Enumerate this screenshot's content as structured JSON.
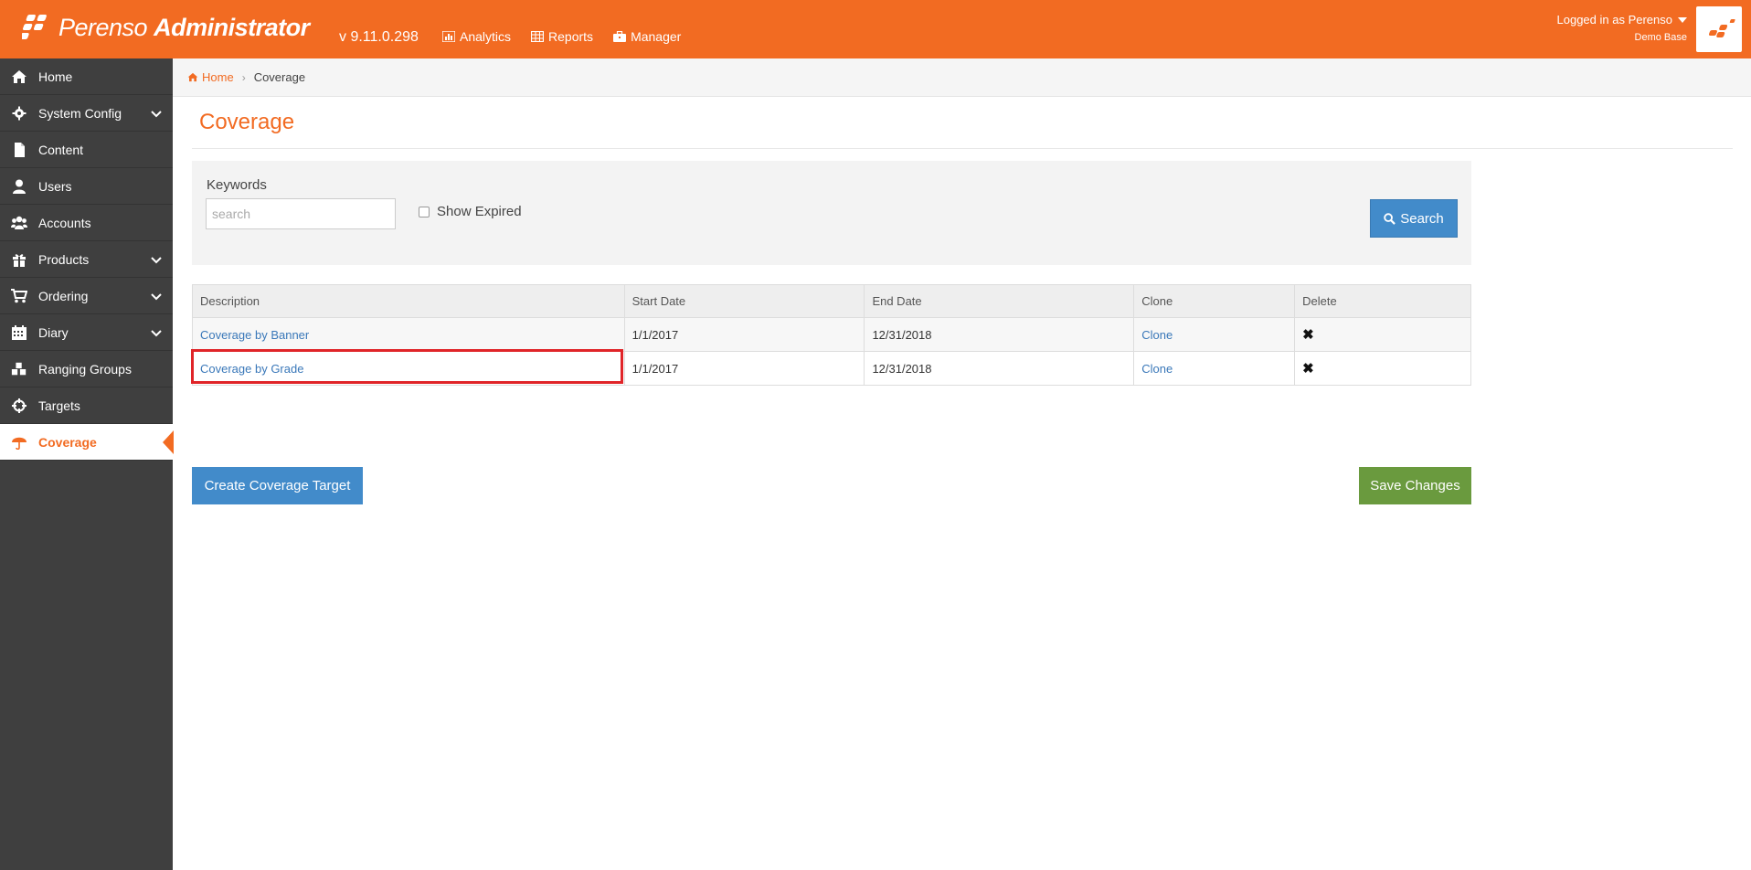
{
  "header": {
    "brand_light": "Perenso",
    "brand_bold": "Administrator",
    "version": "v 9.11.0.298",
    "nav": [
      {
        "label": "Analytics",
        "icon": "bar-chart-icon"
      },
      {
        "label": "Reports",
        "icon": "table-icon"
      },
      {
        "label": "Manager",
        "icon": "briefcase-icon"
      }
    ],
    "login_text": "Logged in as Perenso",
    "account": "Demo Base"
  },
  "sidebar": {
    "items": [
      {
        "label": "Home",
        "icon": "home-icon",
        "expandable": false
      },
      {
        "label": "System Config",
        "icon": "gear-icon",
        "expandable": true
      },
      {
        "label": "Content",
        "icon": "document-icon",
        "expandable": false
      },
      {
        "label": "Users",
        "icon": "user-icon",
        "expandable": false
      },
      {
        "label": "Accounts",
        "icon": "users-icon",
        "expandable": false
      },
      {
        "label": "Products",
        "icon": "gift-icon",
        "expandable": true
      },
      {
        "label": "Ordering",
        "icon": "cart-icon",
        "expandable": true
      },
      {
        "label": "Diary",
        "icon": "calendar-icon",
        "expandable": true
      },
      {
        "label": "Ranging Groups",
        "icon": "cubes-icon",
        "expandable": false
      },
      {
        "label": "Targets",
        "icon": "crosshairs-icon",
        "expandable": false
      },
      {
        "label": "Coverage",
        "icon": "umbrella-icon",
        "expandable": false,
        "active": true
      }
    ]
  },
  "breadcrumb": {
    "home": "Home",
    "current": "Coverage"
  },
  "page": {
    "title": "Coverage"
  },
  "search": {
    "keywords_label": "Keywords",
    "placeholder": "search",
    "value": "",
    "show_expired_label": "Show Expired",
    "show_expired_checked": false,
    "button_label": "Search"
  },
  "table": {
    "columns": [
      "Description",
      "Start Date",
      "End Date",
      "Clone",
      "Delete"
    ],
    "rows": [
      {
        "description": "Coverage by Banner",
        "start": "1/1/2017",
        "end": "12/31/2018",
        "clone": "Clone",
        "delete": "✖"
      },
      {
        "description": "Coverage by Grade",
        "start": "1/1/2017",
        "end": "12/31/2018",
        "clone": "Clone",
        "delete": "✖"
      }
    ]
  },
  "actions": {
    "create_label": "Create Coverage Target",
    "save_label": "Save Changes"
  },
  "colors": {
    "brand_orange": "#f26b22",
    "sidebar_bg": "#3f3f3f",
    "primary_blue": "#428bca",
    "save_green": "#6a9a3e",
    "highlight_red": "#e02428"
  }
}
